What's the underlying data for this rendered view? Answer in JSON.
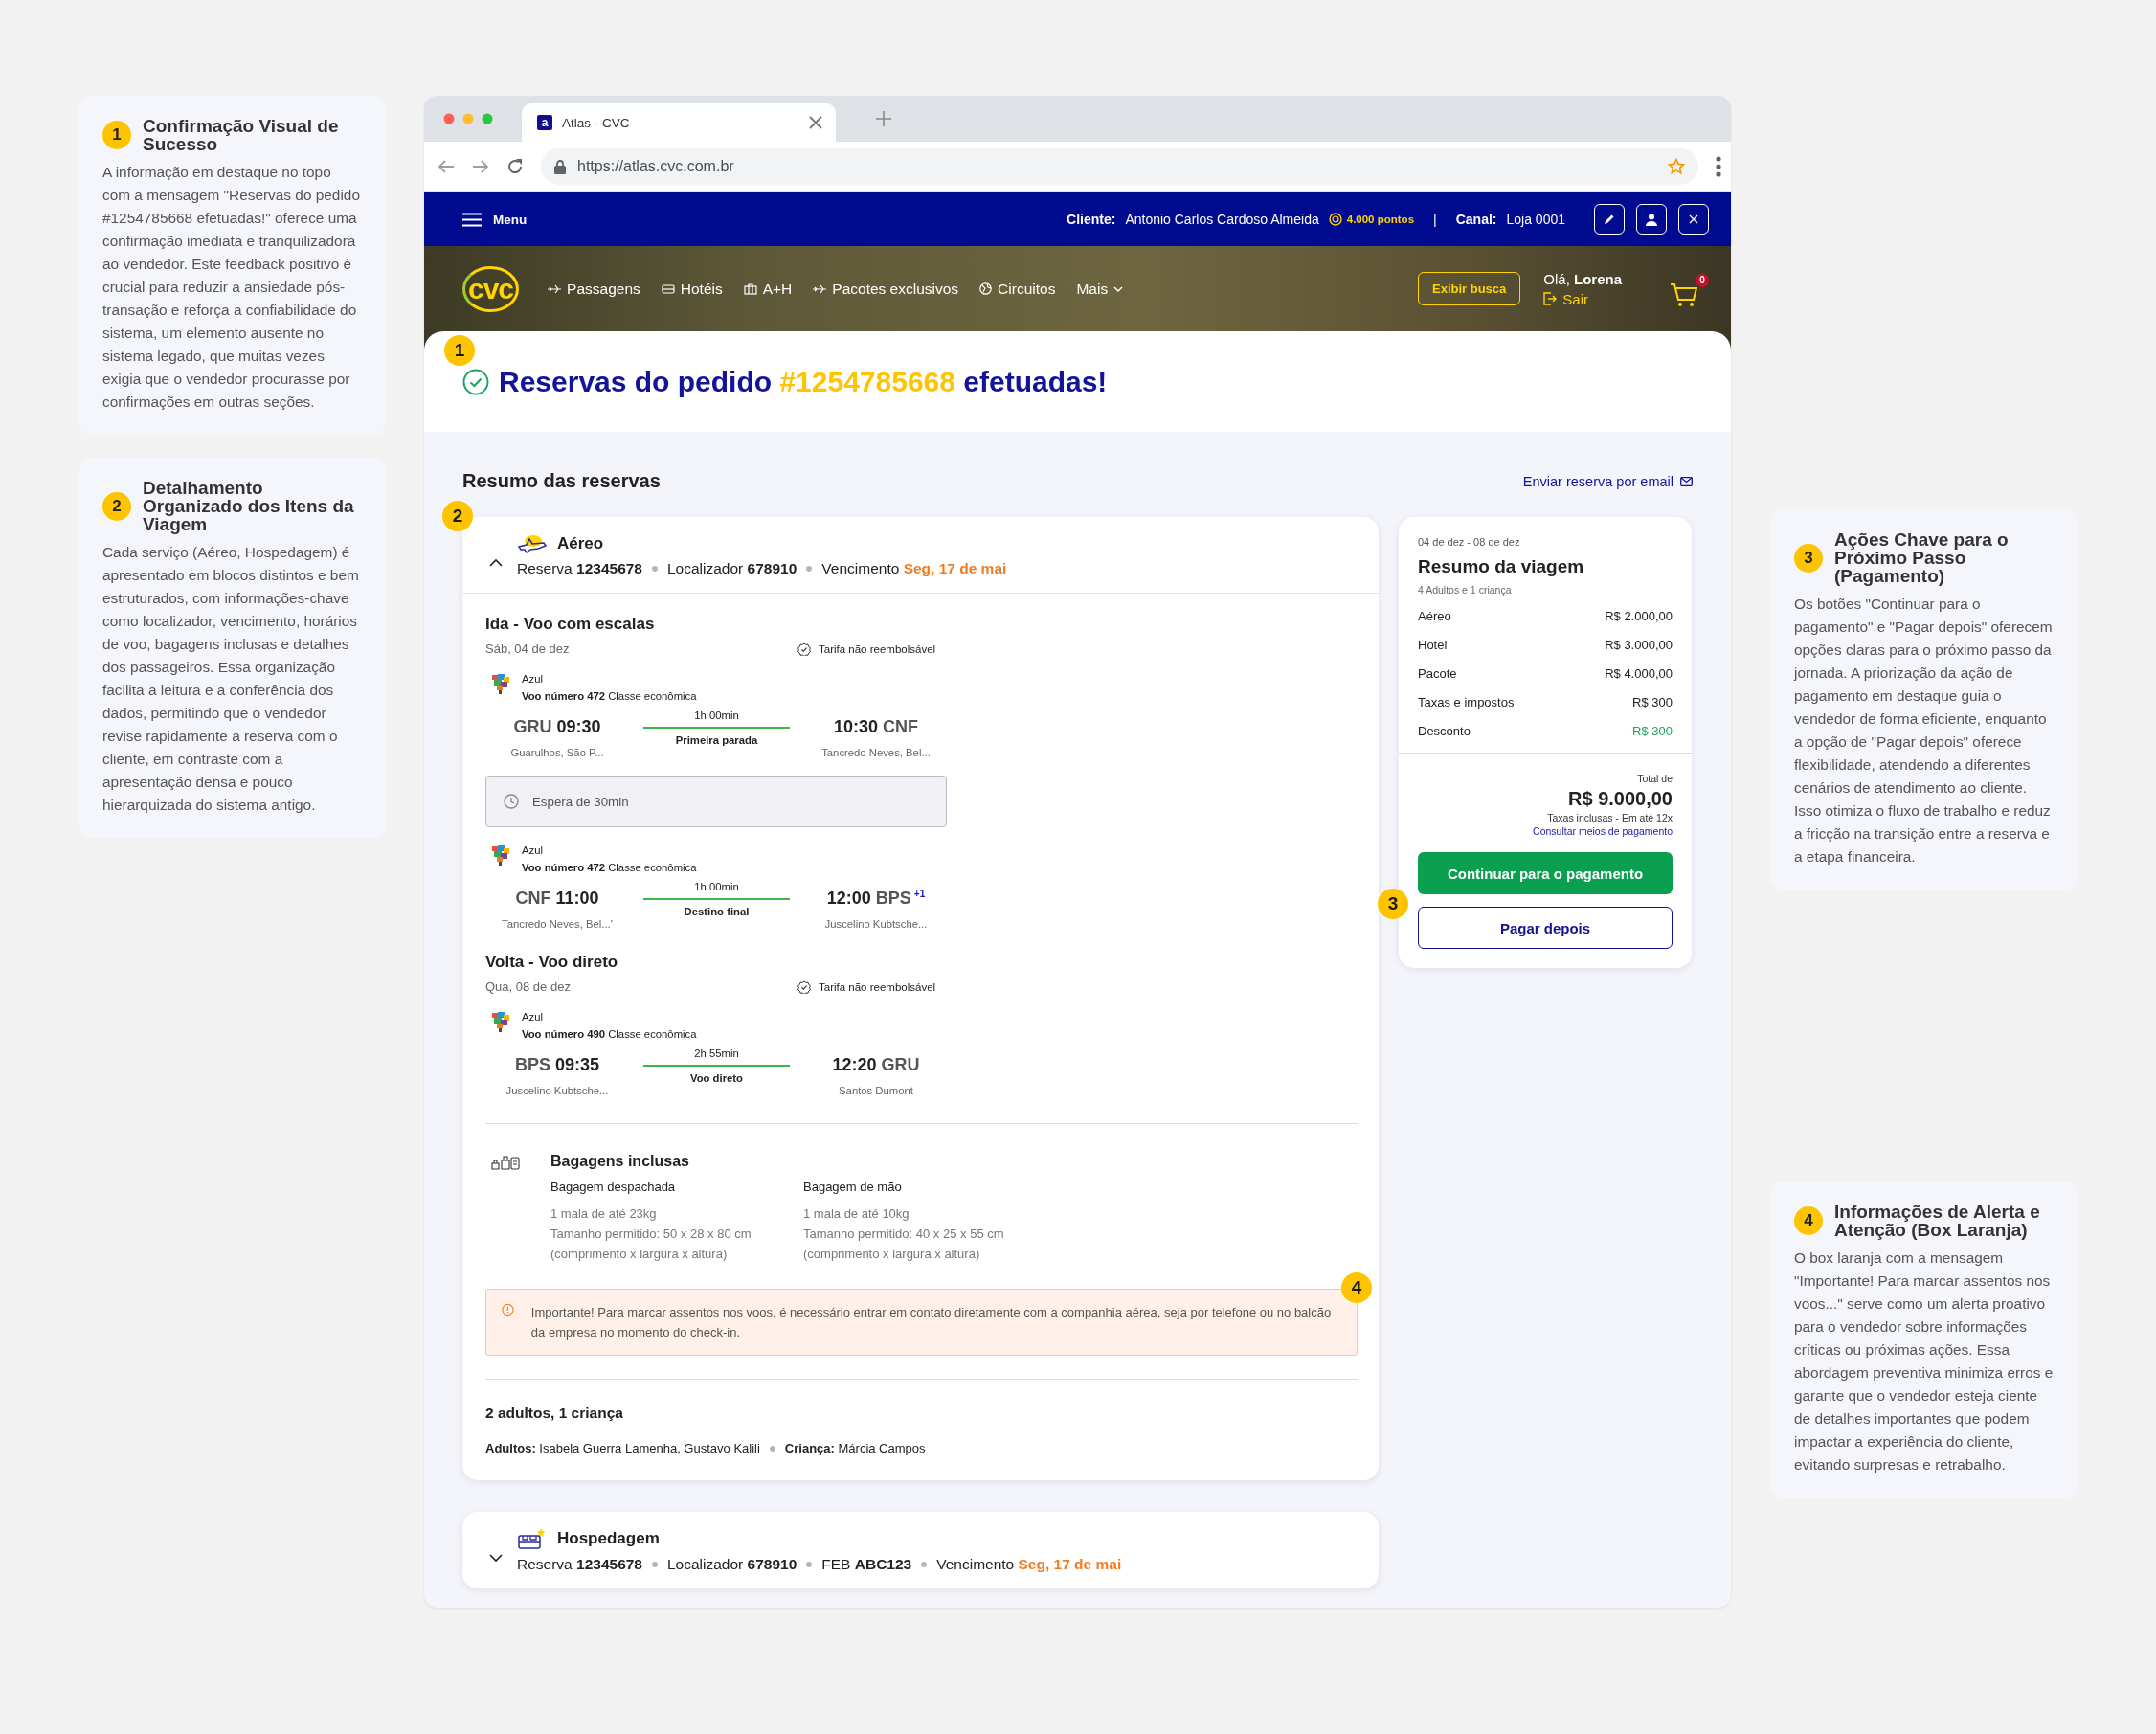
{
  "notes_left": [
    {
      "number": "1",
      "title": "Confirmação Visual de Sucesso",
      "text": "A informação em destaque no topo com a mensagem \"Reservas do pedido #1254785668 efetuadas!\" oferece uma confirmação imediata e tranquilizadora ao vendedor. Este feedback positivo é crucial para reduzir a ansiedade pós-transação e reforça a confiabilidade do sistema, um elemento ausente no sistema legado, que muitas vezes exigia que o vendedor procurasse por confirmações em outras seções."
    },
    {
      "number": "2",
      "title": "Detalhamento Organizado dos Itens da Viagem",
      "text": "Cada serviço (Aéreo, Hospedagem) é apresentado em blocos distintos e bem estruturados, com informações-chave como localizador, vencimento, horários de voo, bagagens inclusas e detalhes dos passageiros. Essa organização facilita a leitura e a conferência dos dados, permitindo que o vendedor revise rapidamente a reserva com o cliente, em contraste com a apresentação densa e pouco hierarquizada do sistema antigo."
    }
  ],
  "notes_right": [
    {
      "number": "3",
      "title": "Ações Chave para o Próximo Passo (Pagamento)",
      "text": "Os botões \"Continuar para o pagamento\" e \"Pagar depois\" oferecem opções claras para o próximo passo da jornada. A priorização da ação de pagamento em destaque guia o vendedor de forma eficiente, enquanto a opção de \"Pagar depois\" oferece flexibilidade, atendendo a diferentes cenários de atendimento ao cliente. Isso otimiza o fluxo de trabalho e reduz a fricção na transição entre a reserva e a etapa financeira."
    },
    {
      "number": "4",
      "title": "Informações de Alerta e Atenção (Box Laranja)",
      "text": "O box laranja com a mensagem \"Importante! Para marcar assentos nos voos...\" serve como um alerta proativo para o vendedor sobre informações críticas ou próximas ações. Essa abordagem preventiva minimiza erros e garante que o vendedor esteja ciente de detalhes importantes que podem impactar a experiência do cliente, evitando surpresas e retrabalho."
    }
  ],
  "browser": {
    "favicon": "a",
    "tab_title": "Atlas - CVC",
    "url": "https://atlas.cvc.com.br"
  },
  "top_bar": {
    "menu": "Menu",
    "client_label": "Cliente:",
    "client_name": "Antonio Carlos Cardoso Almeida",
    "points": "4.000 pontos",
    "separator": "|",
    "channel_label": "Canal:",
    "channel": "Loja 0001"
  },
  "nav": {
    "logo": "cvc",
    "items": [
      {
        "label": "Passagens",
        "kind": "link"
      },
      {
        "label": "Hotéis",
        "kind": "link"
      },
      {
        "label": "A+H",
        "kind": "link"
      },
      {
        "label": "Pacotes exclusivos",
        "kind": "link"
      },
      {
        "label": "Circuitos",
        "kind": "link"
      },
      {
        "label": "Mais",
        "kind": "dropdown"
      }
    ],
    "search_button": "Exibir busca",
    "greeting": "Olá, **Lorena**",
    "logout": "Sair",
    "cart_count": "0"
  },
  "confirmation": {
    "marker": "1",
    "title": "Reservas do pedido **#1254785668** efetuadas!"
  },
  "summary_heading": "Resumo das reservas",
  "email_link": "Enviar reserva por email",
  "bookings": [
    {
      "kind": "flight",
      "title": "Aéreo",
      "expanded": true,
      "marker": "2",
      "meta": [
        {
          "label": "Reserva",
          "value": "12345678",
          "highlight": false
        },
        {
          "label": "Localizador",
          "value": "678910",
          "highlight": false
        },
        {
          "label": "Vencimento",
          "value": "Seg, 17 de mai",
          "highlight": true
        }
      ],
      "legs": [
        {
          "title": "Ida - Voo com escalas",
          "date": "Sáb, 04 de dez",
          "fare": "Tarifa não reembolsável",
          "items": [
            {
              "kind": "segment",
              "airline": "Azul",
              "flight": "**Voo número 472**  Classe econômica",
              "from_code": "GRU",
              "dep": "09:30",
              "from_name": "Guarulhos, São P...",
              "duration": "1h 00min",
              "stop": "Primeira parada",
              "arr": "10:30",
              "to_code": "CNF",
              "to_name": "Tancredo Neves, Bel..."
            },
            {
              "kind": "layover",
              "text": "Espera de 30min"
            },
            {
              "kind": "segment",
              "airline": "Azul",
              "flight": "**Voo número 472**  Classe econômica",
              "from_code": "CNF",
              "dep": "11:00",
              "from_name": "Tancredo Neves, Bel...'",
              "duration": "1h 00min",
              "stop": "Destino final",
              "arr": "12:00",
              "to_code": "BPS",
              "day_offset": "+1",
              "to_name": "Juscelino Kubtsche..."
            }
          ]
        },
        {
          "title": "Volta - Voo direto",
          "date": "Qua, 08 de dez",
          "fare": "Tarifa não reembolsável",
          "items": [
            {
              "kind": "segment",
              "airline": "Azul",
              "flight": "**Voo número 490**  Classe econômica",
              "from_code": "BPS",
              "dep": "09:35",
              "from_name": "Juscelino Kubtsche...",
              "duration": "2h 55min",
              "stop": "Voo direto",
              "arr": "12:20",
              "to_code": "GRU",
              "to_name": "Santos Dumont"
            }
          ]
        }
      ],
      "baggage": {
        "title": "Bagagens inclusas",
        "columns": [
          {
            "title": "Bagagem despachada",
            "lines": [
              "1 mala de até 23kg",
              "Tamanho permitido: 50 x 28 x 80 cm",
              "(comprimento x largura x altura)"
            ]
          },
          {
            "title": "Bagagem de mão",
            "lines": [
              "1 mala de até 10kg",
              "Tamanho permitido: 40 x 25 x 55 cm",
              "(comprimento x largura x altura)"
            ]
          }
        ]
      },
      "alert": {
        "marker": "4",
        "text": "Importante! Para marcar assentos nos voos, é necessário entrar em contato diretamente com a companhia aérea, seja por telefone ou no balcão da empresa no momento do check-in."
      },
      "passengers": {
        "title": "2 adultos, 1 criança",
        "groups": [
          "**Adultos:** Isabela Guerra Lamenha, Gustavo Kalili",
          "**Criança:** Márcia Campos"
        ]
      }
    },
    {
      "kind": "hotel",
      "title": "Hospedagem",
      "expanded": false,
      "meta": [
        {
          "label": "Reserva",
          "value": "12345678",
          "highlight": false
        },
        {
          "label": "Localizador",
          "value": "678910",
          "highlight": false
        },
        {
          "label": "FEB",
          "value": "ABC123",
          "highlight": false
        },
        {
          "label": "Vencimento",
          "value": "Seg, 17 de mai",
          "highlight": true
        }
      ]
    }
  ],
  "trip_summary": {
    "dates": "04 de dez - 08 de dez",
    "title": "Resumo da viagem",
    "travellers": "4 Adultos e 1 criança",
    "lines": [
      {
        "label": "Aéreo",
        "value": "R$ 2.000,00",
        "kind": "charge"
      },
      {
        "label": "Hotel",
        "value": "R$ 3.000,00",
        "kind": "charge"
      },
      {
        "label": "Pacote",
        "value": "R$ 4.000,00",
        "kind": "charge"
      },
      {
        "label": "Taxas e impostos",
        "value": "R$ 300",
        "kind": "charge"
      },
      {
        "label": "Desconto",
        "value": "- R$ 300",
        "kind": "discount"
      }
    ],
    "total_label": "Total de",
    "total": "R$ 9.000,00",
    "installments": "Taxas inclusas - Em até 12x",
    "payment_link": "Consultar meios de pagamento",
    "primary_button": "Continuar para o pagamento",
    "secondary_button": "Pagar depois",
    "marker": "3"
  }
}
